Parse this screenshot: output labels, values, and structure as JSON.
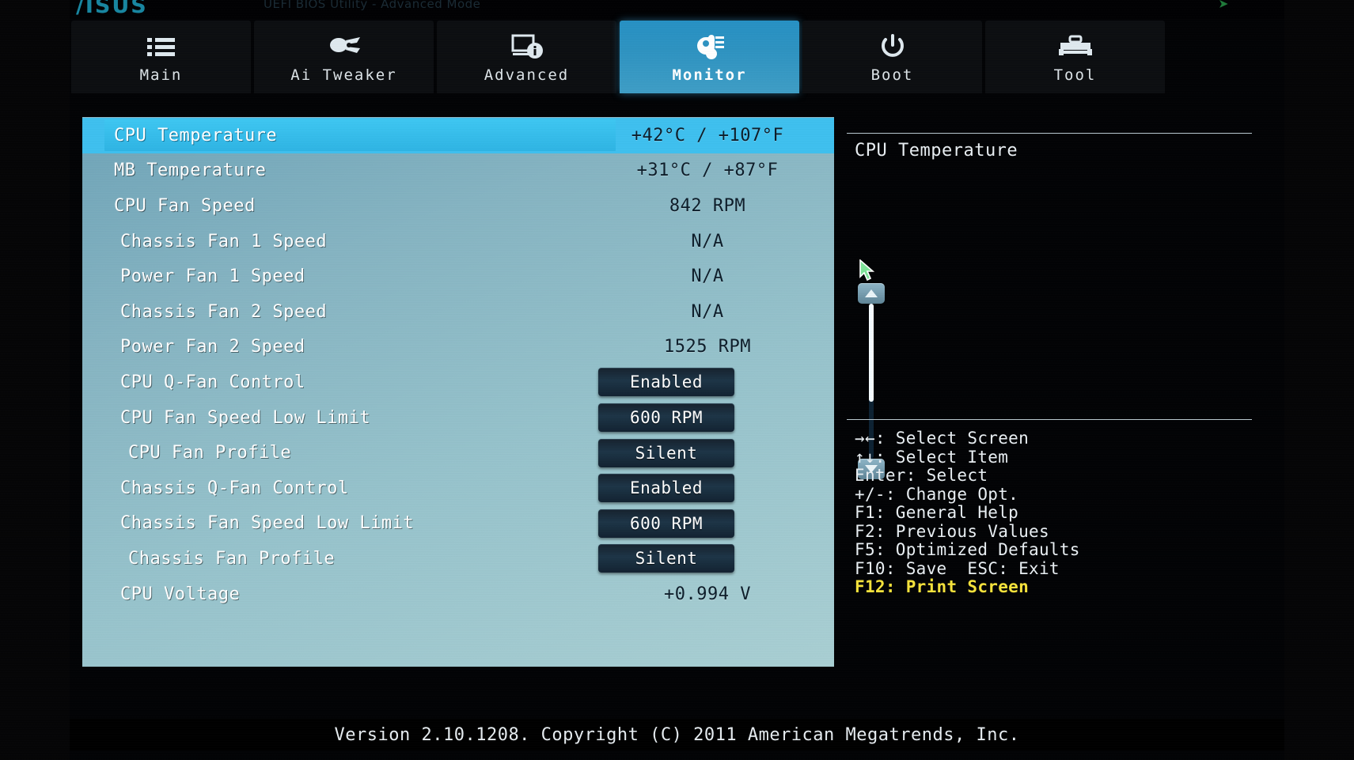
{
  "brand": {
    "logo": "/ISUS",
    "tagline": "UEFI BIOS Utility - Advanced Mode",
    "arrow": "➤"
  },
  "tabs": [
    {
      "label": "Main",
      "icon": "list-icon",
      "active": false
    },
    {
      "label": "Ai Tweaker",
      "icon": "tweaker-icon",
      "active": false
    },
    {
      "label": "Advanced",
      "icon": "advanced-icon",
      "active": false
    },
    {
      "label": "Monitor",
      "icon": "thermometer-icon",
      "active": true
    },
    {
      "label": "Boot",
      "icon": "power-icon",
      "active": false
    },
    {
      "label": "Tool",
      "icon": "toolbox-icon",
      "active": false
    }
  ],
  "settings": [
    {
      "label": "CPU Temperature",
      "value": "+42°C / +107°F",
      "kind": "readonly",
      "indent": 0,
      "highlighted": true
    },
    {
      "label": "MB Temperature",
      "value": "+31°C / +87°F",
      "kind": "readonly",
      "indent": 0,
      "highlighted": false
    },
    {
      "label": "CPU Fan Speed",
      "value": "842 RPM",
      "kind": "readonly",
      "indent": 0,
      "highlighted": false
    },
    {
      "label": "Chassis Fan 1 Speed",
      "value": "N/A",
      "kind": "readonly",
      "indent": 1,
      "highlighted": false
    },
    {
      "label": "Power Fan 1 Speed",
      "value": "N/A",
      "kind": "readonly",
      "indent": 1,
      "highlighted": false
    },
    {
      "label": "Chassis Fan 2 Speed",
      "value": "N/A",
      "kind": "readonly",
      "indent": 1,
      "highlighted": false
    },
    {
      "label": "Power Fan 2 Speed",
      "value": "1525 RPM",
      "kind": "readonly",
      "indent": 1,
      "highlighted": false
    },
    {
      "label": "CPU Q-Fan Control",
      "value": "Enabled",
      "kind": "option",
      "indent": 1,
      "highlighted": false
    },
    {
      "label": "CPU Fan Speed Low Limit",
      "value": "600 RPM",
      "kind": "option",
      "indent": 1,
      "highlighted": false
    },
    {
      "label": "CPU Fan Profile",
      "value": "Silent",
      "kind": "option",
      "indent": 2,
      "highlighted": false
    },
    {
      "label": "Chassis Q-Fan Control",
      "value": "Enabled",
      "kind": "option",
      "indent": 1,
      "highlighted": false
    },
    {
      "label": "Chassis Fan Speed Low Limit",
      "value": "600 RPM",
      "kind": "option",
      "indent": 1,
      "highlighted": false
    },
    {
      "label": "Chassis Fan Profile",
      "value": "Silent",
      "kind": "option",
      "indent": 2,
      "highlighted": false
    },
    {
      "label": "CPU Voltage",
      "value": "+0.994 V",
      "kind": "readonly",
      "indent": 1,
      "highlighted": false
    }
  ],
  "scrollbar": {
    "up_arrow": "▲",
    "down_arrow": "▼",
    "thumb_position_percent": 0
  },
  "help": {
    "title": "CPU Temperature",
    "keys": [
      {
        "text": "→←: Select Screen",
        "accent": false
      },
      {
        "text": "↑↓: Select Item",
        "accent": false
      },
      {
        "text": "Enter: Select",
        "accent": false
      },
      {
        "text": "+/-: Change Opt.",
        "accent": false
      },
      {
        "text": "F1: General Help",
        "accent": false
      },
      {
        "text": "F2: Previous Values",
        "accent": false
      },
      {
        "text": "F5: Optimized Defaults",
        "accent": false
      },
      {
        "text": "F10: Save  ESC: Exit",
        "accent": false
      },
      {
        "text": "F12: Print Screen",
        "accent": true
      }
    ]
  },
  "footer": {
    "text": "Version 2.10.1208. Copyright (C) 2011 American Megatrends, Inc."
  },
  "colors": {
    "accent_highlight": "#3fc0ef",
    "tab_active": "#2e93c1",
    "panel_gradient_top": "#6fa4b8",
    "panel_gradient_bottom": "#a9cfd3",
    "help_accent": "#f6e33c",
    "option_button": "#1d3547"
  }
}
